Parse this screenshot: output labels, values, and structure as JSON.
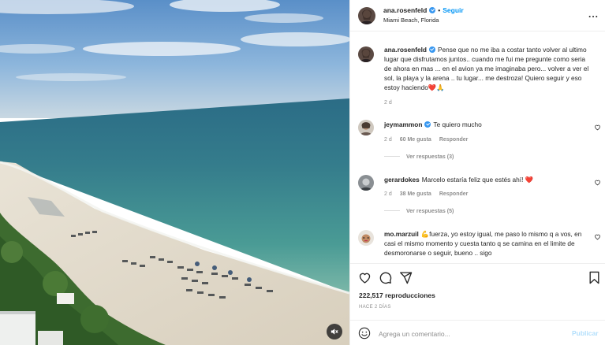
{
  "post": {
    "author": "ana.rosenfeld",
    "location": "Miami Beach, Florida",
    "follow_label": "Seguir",
    "separator": "•",
    "more_label": "...",
    "caption": {
      "username": "ana.rosenfeld",
      "text": "Pense que no me iba a costar tanto volver al ultimo lugar que disfrutamos juntos.. cuando me fui me pregunte como seria de ahora en mas ... en el avion ya me imaginaba pero... volver a ver el sol, la playa y la arena .. tu lugar... me destroza! Quiero seguir y eso estoy haciendo❤️🙏",
      "time": "2 d"
    },
    "comments": [
      {
        "username": "jeymammon",
        "verified": true,
        "text": "Te quiero mucho",
        "time": "2 d",
        "likes": "60 Me gusta",
        "reply_label": "Responder",
        "replies_label": "Ver respuestas (3)"
      },
      {
        "username": "gerardokes",
        "verified": false,
        "text": "Marcelo estaría feliz que estés ahí! ❤️",
        "time": "2 d",
        "likes": "38 Me gusta",
        "reply_label": "Responder",
        "replies_label": "Ver respuestas (5)"
      },
      {
        "username": "mo.marzuil",
        "verified": false,
        "text": "💪fuerza, yo estoy igual, me paso lo mismo q a vos, en casi el mismo momento y cuesta tanto q se camina en el limite de desmoronarse o seguir, bueno .. sigo"
      }
    ],
    "views": "222,517 reproducciones",
    "posted_ago": "HACE 2 DÍAS",
    "add_comment": {
      "placeholder": "Agrega un comentario...",
      "publish_label": "Publicar"
    }
  },
  "icons": [
    "verified-badge-icon",
    "more-options-icon",
    "heart-icon",
    "comment-icon",
    "share-icon",
    "bookmark-icon",
    "emoji-icon",
    "mute-icon"
  ],
  "colors": {
    "link_blue": "#0095f6",
    "verified_blue": "#3897f0",
    "publish_disabled": "#b2dffc",
    "heart_red": "#ed4956"
  }
}
